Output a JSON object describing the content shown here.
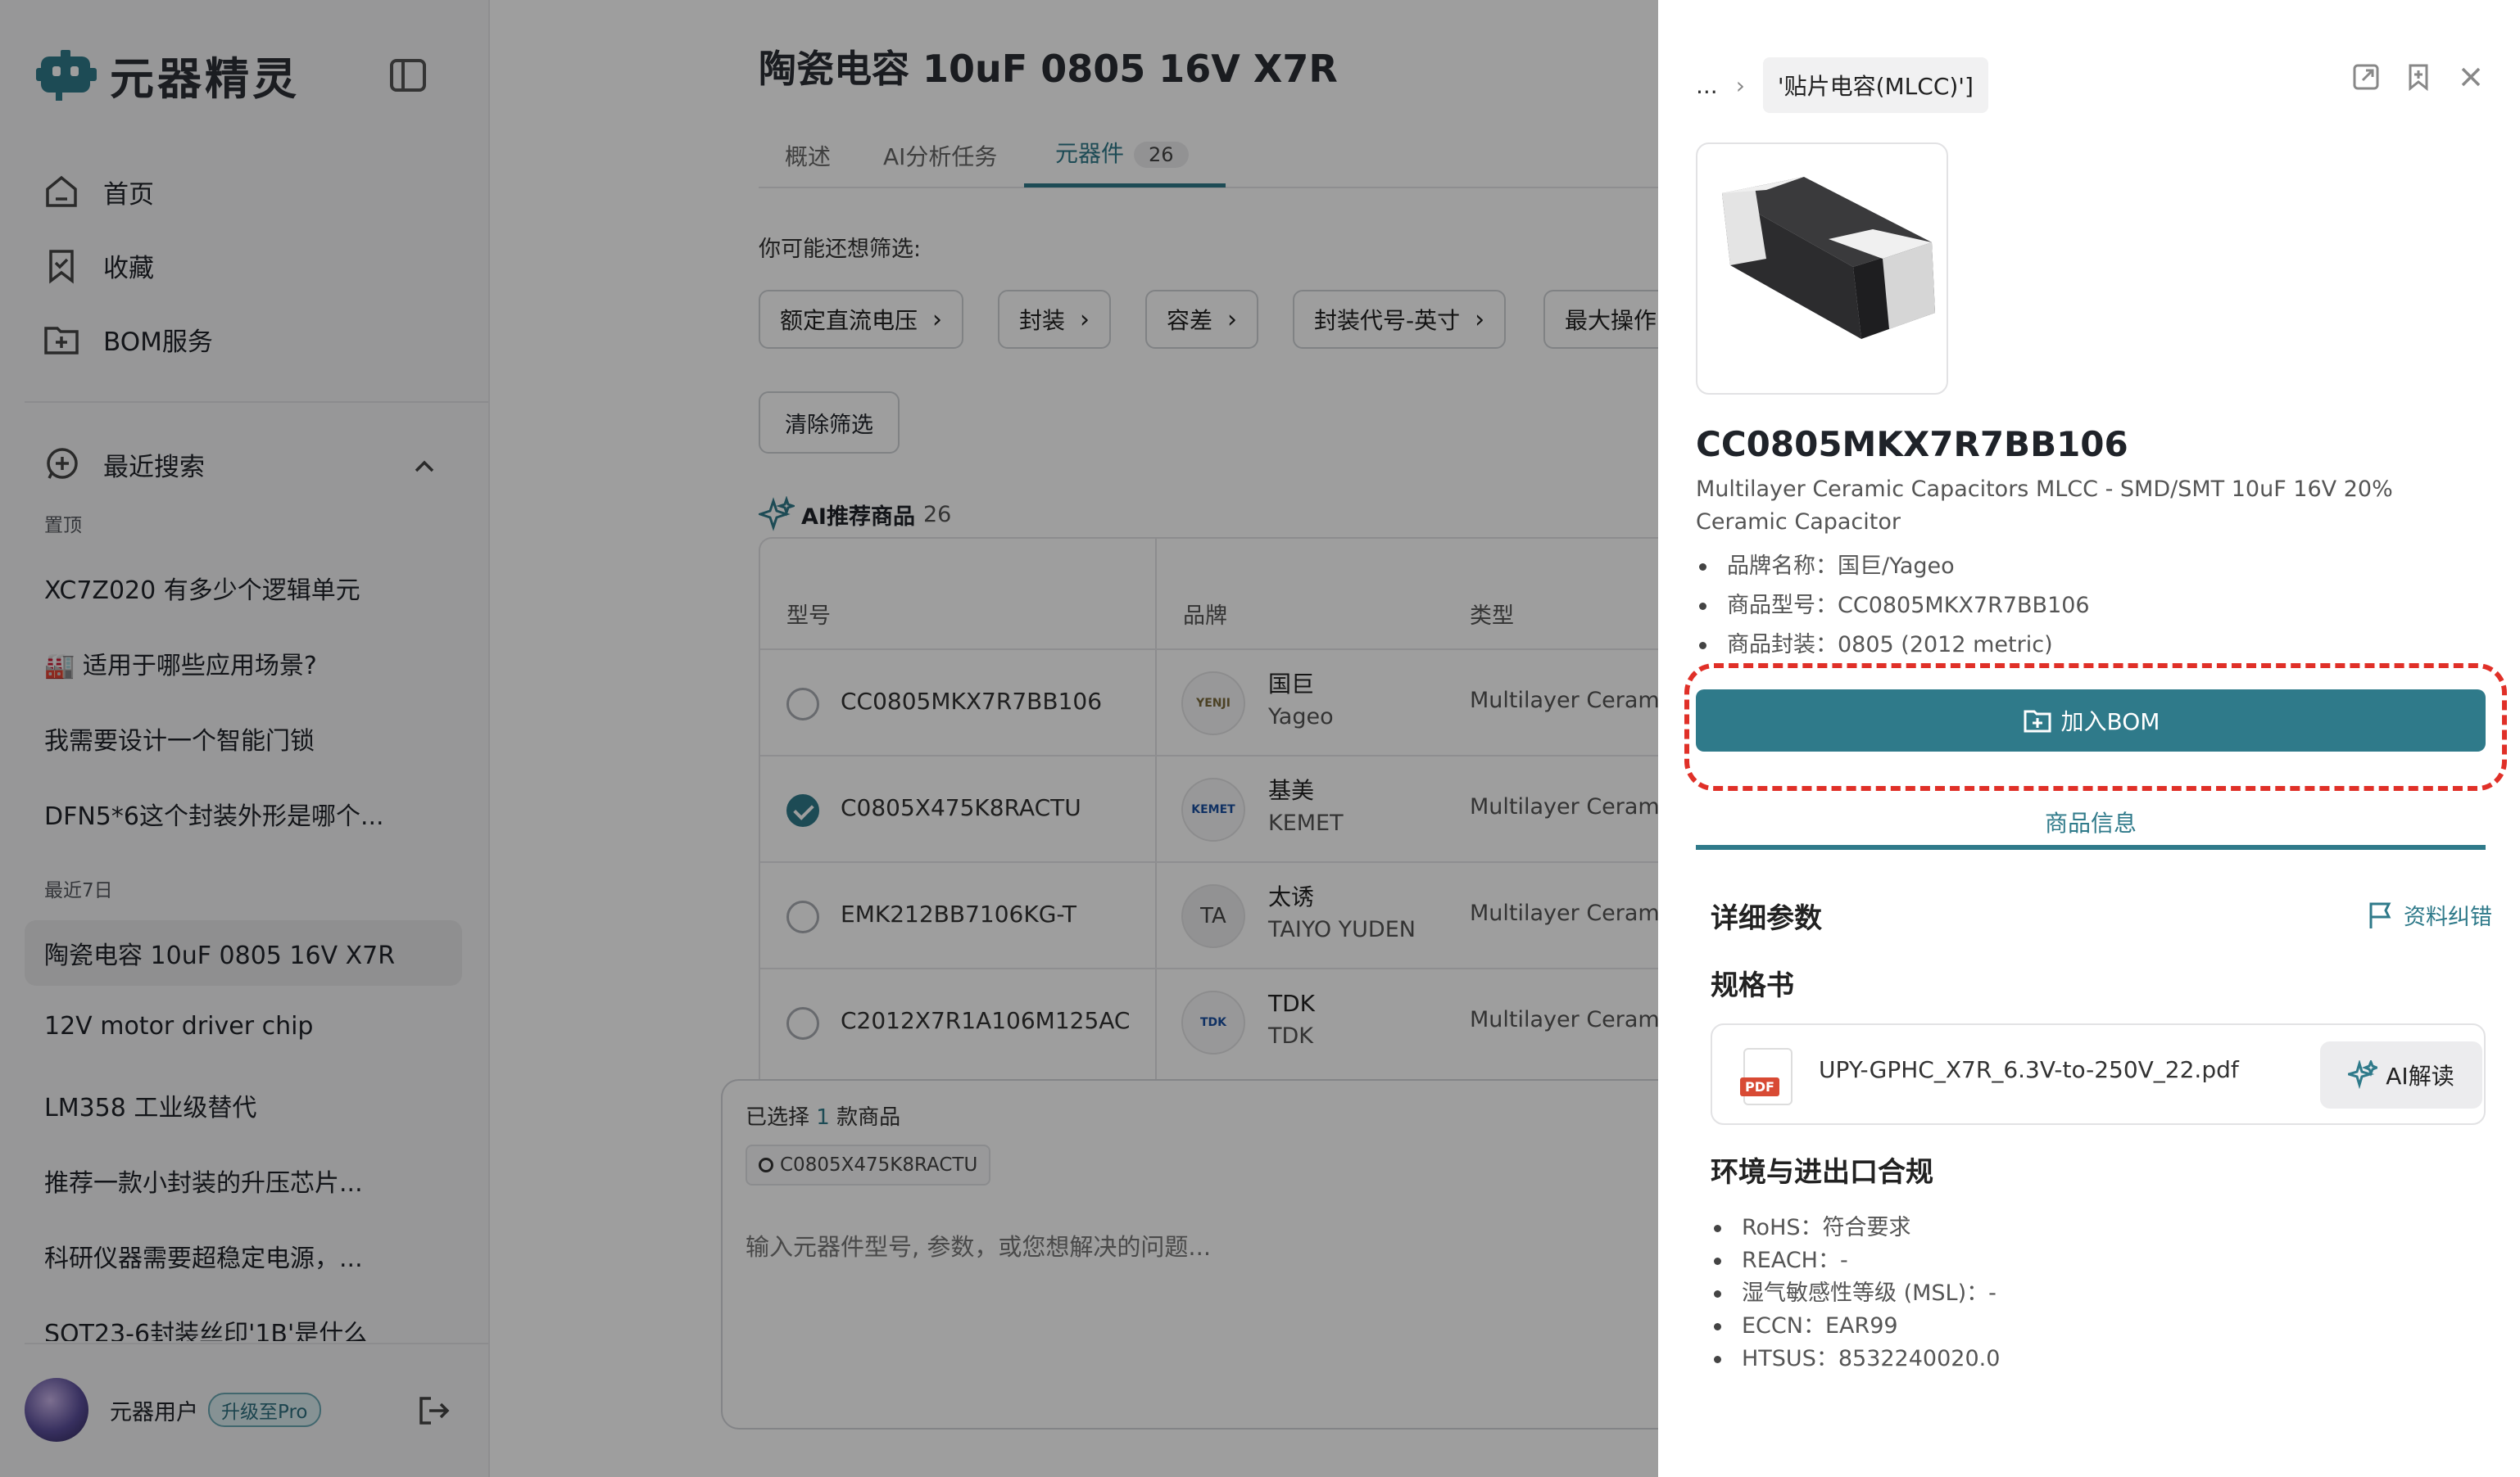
{
  "app": {
    "name": "元器精灵"
  },
  "sidebar": {
    "nav": [
      {
        "label": "首页",
        "icon": "home-icon"
      },
      {
        "label": "收藏",
        "icon": "bookmark-icon"
      },
      {
        "label": "BOM服务",
        "icon": "folder-plus-icon"
      }
    ],
    "recent_label": "最近搜索",
    "pinned_label": "置顶",
    "pinned": [
      "XC7Z020 有多少个逻辑单元",
      "🏭 适用于哪些应用场景?",
      "我需要设计一个智能门锁",
      "DFN5*6这个封装外形是哪个..."
    ],
    "week_label": "最近7日",
    "week": [
      "陶瓷电容 10uF 0805 16V X7R",
      "12V motor driver chip",
      "LM358 工业级替代",
      "推荐一款小封装的升压芯片...",
      "科研仪器需要超稳定电源，...",
      "SOT23-6封装丝印'1B'是什么"
    ],
    "user": {
      "name": "元器用户",
      "upgrade": "升级至Pro"
    }
  },
  "main": {
    "title": "陶瓷电容 10uF 0805 16V X7R",
    "tabs": [
      {
        "label": "概述"
      },
      {
        "label": "AI分析任务"
      },
      {
        "label": "元器件",
        "count": "26"
      }
    ],
    "hint": "你可能还想筛选:",
    "filters": [
      "额定直流电压",
      "封装",
      "容差",
      "封装代号-英寸",
      "最大操作"
    ],
    "clear": "清除筛选",
    "ai_rec": {
      "label": "AI推荐商品",
      "count": "26"
    },
    "table": {
      "headers": [
        "型号",
        "品牌",
        "类型"
      ],
      "rows": [
        {
          "model": "CC0805MKX7R7BB106",
          "brand_cn": "国巨",
          "brand_en": "Yageo",
          "logo": "YENJI",
          "type": "Multilayer Ceramic",
          "checked": false
        },
        {
          "model": "C0805X475K8RACTU",
          "brand_cn": "基美",
          "brand_en": "KEMET",
          "logo": "KEMET",
          "type": "Multilayer Ceramic",
          "checked": true
        },
        {
          "model": "EMK212BB7106KG-T",
          "brand_cn": "太诱",
          "brand_en": "TAIYO YUDEN",
          "logo": "TA",
          "type": "Multilayer Ceramic",
          "checked": false
        },
        {
          "model": "C2012X7R1A106M125AC",
          "brand_cn": "TDK",
          "brand_en": "TDK",
          "logo": "TDK",
          "type": "Multilayer Ceramic",
          "checked": false
        }
      ]
    },
    "composer": {
      "selected_pre": "已选择 ",
      "selected_count": "1",
      "selected_post": " 款商品",
      "chip": "C0805X475K8RACTU",
      "placeholder": "输入元器件型号, 参数，或您想解决的问题..."
    }
  },
  "panel": {
    "crumb_more": "...",
    "crumb_current": "'贴片电容(MLCC)']",
    "part": "CC0805MKX7R7BB106",
    "desc": "Multilayer Ceramic Capacitors MLCC - SMD/SMT 10uF 16V 20% Ceramic Capacitor",
    "specs": [
      "品牌名称：国巨/Yageo",
      "商品型号：CC0805MKX7R7BB106",
      "商品封装：0805 (2012 metric)"
    ],
    "bom_button": "加入BOM",
    "tab": "商品信息",
    "detail_title": "详细参数",
    "feedback": "资料纠错",
    "datasheet_title": "规格书",
    "file": {
      "name": "UPY-GPHC_X7R_6.3V-to-250V_22.pdf",
      "badge": "PDF",
      "ai": "AI解读"
    },
    "compliance_title": "环境与进出口合规",
    "compliance": [
      "RoHS：符合要求",
      "REACH：-",
      "湿气敏感性等级 (MSL)：-",
      "ECCN：EAR99",
      "HTSUS：8532240020.0"
    ]
  },
  "colors": {
    "accent": "#2f7a8a",
    "highlight": "#e03028"
  }
}
